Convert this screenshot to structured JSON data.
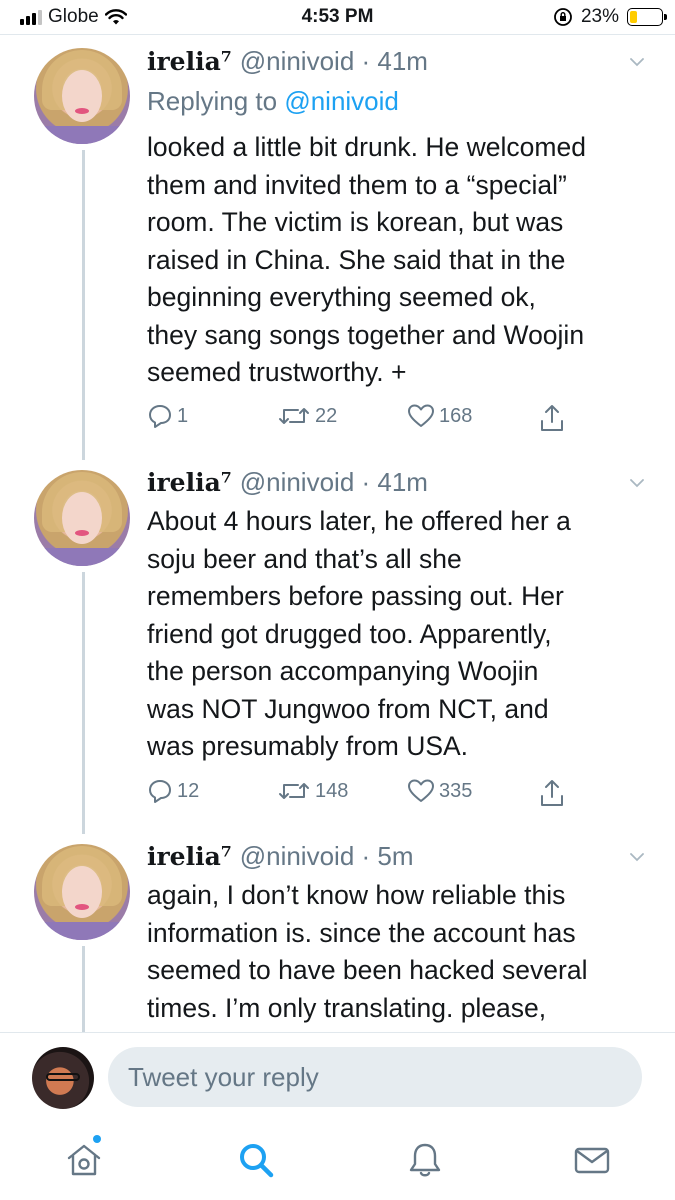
{
  "status_bar": {
    "carrier": "Globe",
    "time": "4:53 PM",
    "battery_percent": "23%",
    "battery_level": 0.23,
    "icons": [
      "signal-icon",
      "wifi-icon",
      "orientation-lock-icon",
      "battery-icon"
    ]
  },
  "tweets": [
    {
      "name": "irelia⁷",
      "handle": "@ninivoid · 41m",
      "replying_prefix": "Replying to ",
      "replying_handle": "@ninivoid",
      "lines": [
        "looked a little bit drunk. He welcomed",
        "them and invited them to a “special”",
        "room. The victim is korean, but was",
        "raised in China. She said that in the",
        "beginning everything seemed ok,",
        "they sang songs together and Woojin",
        "seemed trustworthy. +"
      ],
      "replies": "1",
      "retweets": "22",
      "likes": "168"
    },
    {
      "name": "irelia⁷",
      "handle": "@ninivoid · 41m",
      "lines": [
        "About 4 hours later, he offered her a",
        "soju beer and that’s all she",
        "remembers before passing out. Her",
        "friend got drugged too. Apparently,",
        "the person accompanying Woojin",
        "was NOT Jungwoo from NCT, and",
        "was presumably from USA."
      ],
      "replies": "12",
      "retweets": "148",
      "likes": "335"
    },
    {
      "name": "irelia⁷",
      "handle": "@ninivoid · 5m",
      "lines": [
        "again, I don’t know how reliable this",
        "information is. since the account has",
        "seemed to have been hacked several",
        "times. I’m only translating. please,"
      ]
    }
  ],
  "reply_bar": {
    "placeholder": "Tweet your reply"
  },
  "tab_bar": {
    "items": [
      "home-icon",
      "search-icon",
      "notifications-icon",
      "messages-icon"
    ],
    "active": "search-icon",
    "accent": "#1da1f2"
  }
}
